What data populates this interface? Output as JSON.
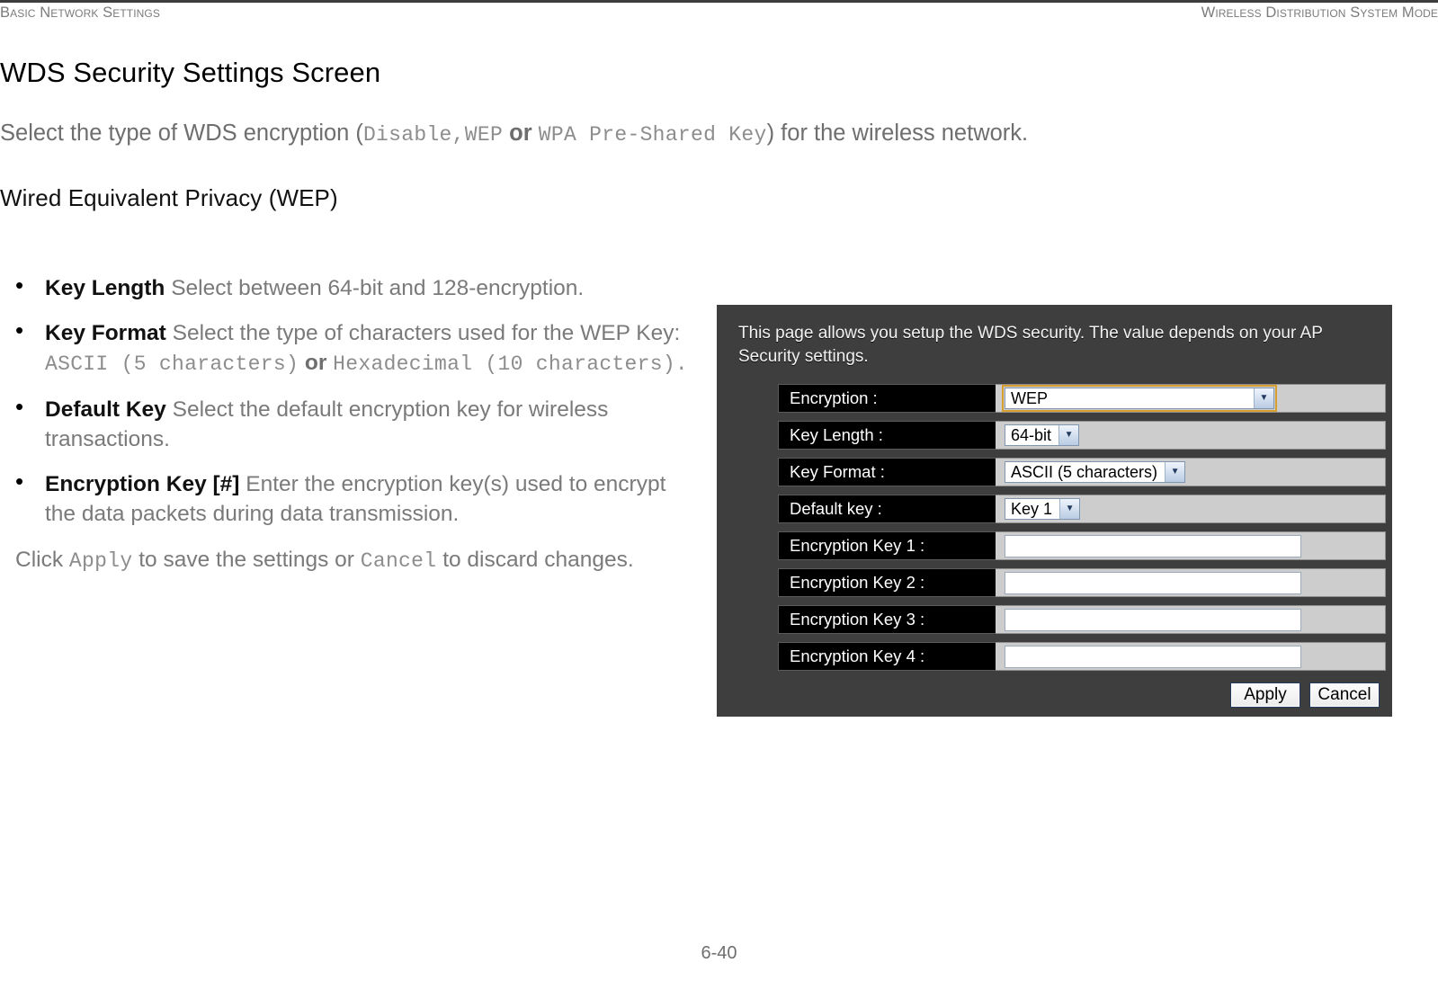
{
  "header": {
    "left": "Basic Network Settings",
    "right": "Wireless Distribution System Mode"
  },
  "document": {
    "screen_title": "WDS Security Settings Screen",
    "intro_lead": "Select the type of WDS encryption (",
    "intro_opt1": "Disable,",
    "intro_opt2": "WEP",
    "intro_or": "or",
    "intro_opt3": "WPA Pre-Shared Key",
    "intro_tail": ") for the wireless network.",
    "sub_title": "Wired Equivalent Privacy (WEP)",
    "page_number": "6-40"
  },
  "bullets": [
    {
      "term": "Key Length",
      "desc": "Select between 64-bit and 128-encryption."
    },
    {
      "term": "Key Format",
      "desc_a": "Select the type of characters used for the WEP Key:",
      "mono_a": "ASCII (5 characters)",
      "mid": "or",
      "mono_b": "Hexadecimal (10 characters)."
    },
    {
      "term": "Default Key",
      "desc": "Select the default encryption key for wireless transactions."
    },
    {
      "term": "Encryption Key [#]",
      "desc": "Enter the encryption key(s) used to encrypt the data packets during data transmission."
    }
  ],
  "click_note": {
    "lead": "Click",
    "apply": "Apply",
    "mid": "to save the settings or",
    "cancel": "Cancel",
    "tail": "to discard changes."
  },
  "screenshot": {
    "description": "This page allows you setup the WDS security. The value depends on your AP Security settings.",
    "rows": [
      {
        "label": "Encryption :",
        "control": "select",
        "value": "WEP",
        "focused": true,
        "width": "wide"
      },
      {
        "label": "Key Length :",
        "control": "select",
        "value": "64-bit",
        "focused": false,
        "width": "auto"
      },
      {
        "label": "Key Format :",
        "control": "select",
        "value": "ASCII (5 characters)",
        "focused": false,
        "width": "auto"
      },
      {
        "label": "Default key :",
        "control": "select",
        "value": "Key 1",
        "focused": false,
        "width": "auto"
      },
      {
        "label": "Encryption Key 1 :",
        "control": "text",
        "value": "",
        "focused": false,
        "width": "auto"
      },
      {
        "label": "Encryption Key 2 :",
        "control": "text",
        "value": "",
        "focused": false,
        "width": "auto"
      },
      {
        "label": "Encryption Key 3 :",
        "control": "text",
        "value": "",
        "focused": false,
        "width": "auto"
      },
      {
        "label": "Encryption Key 4 :",
        "control": "text",
        "value": "",
        "focused": false,
        "width": "auto"
      }
    ],
    "buttons": {
      "apply": "Apply",
      "cancel": "Cancel"
    },
    "colors": {
      "panel_bg": "#3e3e3e",
      "label_bg": "#000000",
      "value_bg": "#cdcdcd",
      "focus_outline": "#d7a02e"
    }
  }
}
